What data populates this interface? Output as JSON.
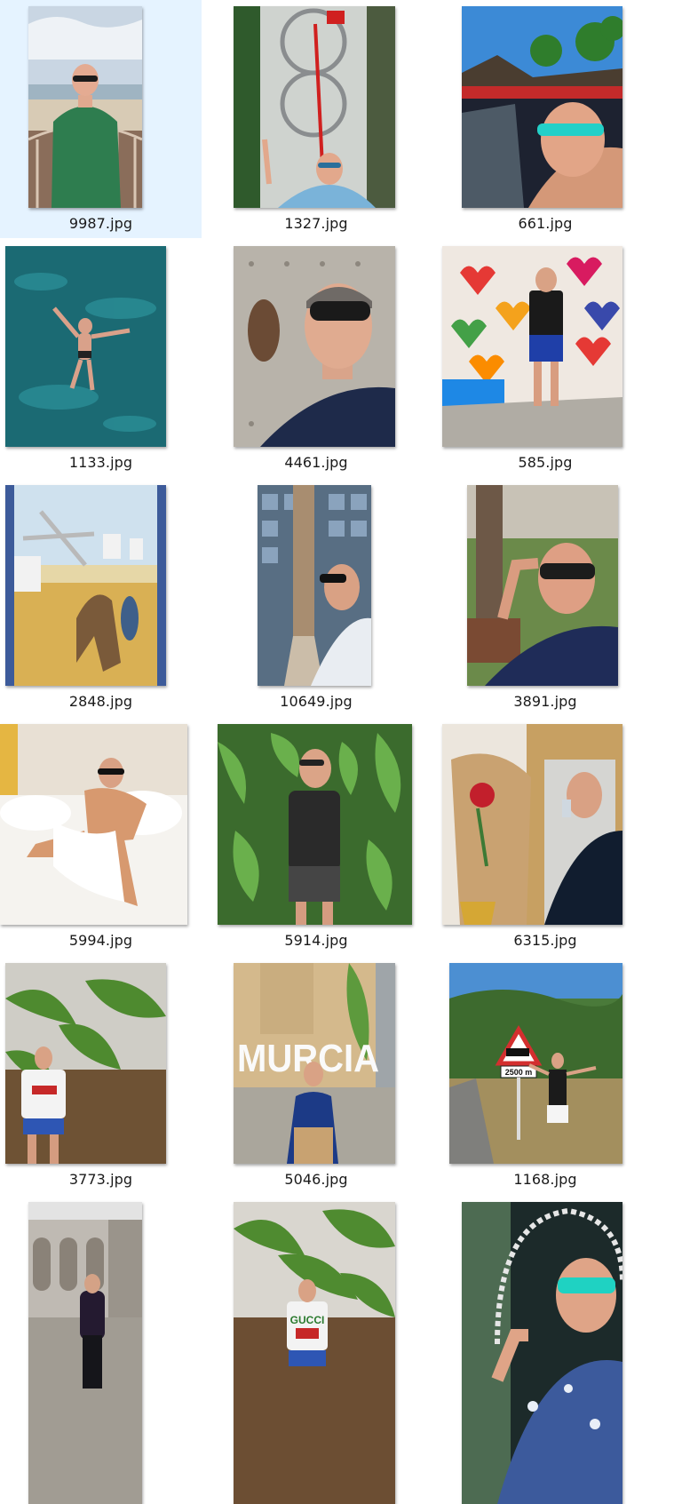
{
  "gallery": {
    "items": [
      {
        "name": "9987.jpg",
        "selected": true,
        "scene": "person-coast"
      },
      {
        "name": "1327.jpg",
        "selected": false,
        "scene": "atrium-selfie"
      },
      {
        "name": "661.jpg",
        "selected": false,
        "scene": "pool-selfie"
      },
      {
        "name": "1133.jpg",
        "selected": false,
        "scene": "floating-sea"
      },
      {
        "name": "4461.jpg",
        "selected": false,
        "scene": "door-portrait"
      },
      {
        "name": "585.jpg",
        "selected": false,
        "scene": "heart-wall"
      },
      {
        "name": "2848.jpg",
        "selected": false,
        "scene": "tile-mural"
      },
      {
        "name": "10649.jpg",
        "selected": false,
        "scene": "column-portrait"
      },
      {
        "name": "3891.jpg",
        "selected": false,
        "scene": "park-portrait"
      },
      {
        "name": "5994.jpg",
        "selected": false,
        "scene": "bed"
      },
      {
        "name": "5914.jpg",
        "selected": false,
        "scene": "ferns"
      },
      {
        "name": "6315.jpg",
        "selected": false,
        "scene": "mirror-roses"
      },
      {
        "name": "3773.jpg",
        "selected": false,
        "scene": "banana-plantation"
      },
      {
        "name": "5046.jpg",
        "selected": false,
        "scene": "murcia-sign",
        "photo_text": "MURCIA"
      },
      {
        "name": "1168.jpg",
        "selected": false,
        "scene": "road-sign",
        "photo_text": "2500 m"
      },
      {
        "name": "",
        "selected": false,
        "scene": "cloister"
      },
      {
        "name": "",
        "selected": false,
        "scene": "banana-plantation-2",
        "photo_text": "GUCCI"
      },
      {
        "name": "",
        "selected": false,
        "scene": "jewel-selfie"
      }
    ]
  }
}
